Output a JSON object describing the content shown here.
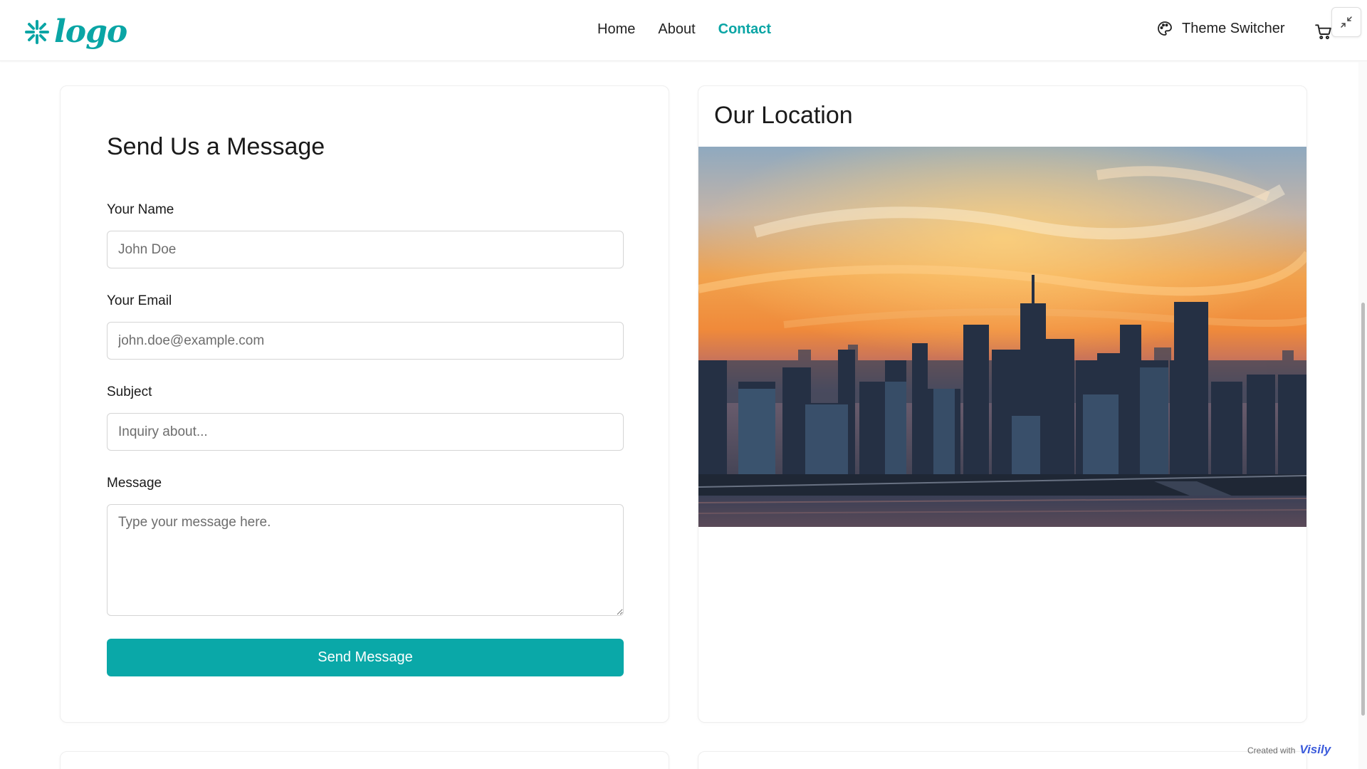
{
  "header": {
    "logo_text": "logo",
    "nav": [
      {
        "label": "Home",
        "active": false
      },
      {
        "label": "About",
        "active": false
      },
      {
        "label": "Contact",
        "active": true
      }
    ],
    "theme_switcher_label": "Theme Switcher"
  },
  "form": {
    "title": "Send Us a Message",
    "name_label": "Your Name",
    "name_placeholder": "John Doe",
    "email_label": "Your Email",
    "email_placeholder": "john.doe@example.com",
    "subject_label": "Subject",
    "subject_placeholder": "Inquiry about...",
    "message_label": "Message",
    "message_placeholder": "Type your message here.",
    "submit_label": "Send Message"
  },
  "location": {
    "title": "Our Location"
  },
  "footer_badge": {
    "text": "Created with",
    "brand": "Visily"
  },
  "colors": {
    "accent": "#0aa8a8",
    "text": "#1a1a1a",
    "border": "#d5d5d5"
  }
}
